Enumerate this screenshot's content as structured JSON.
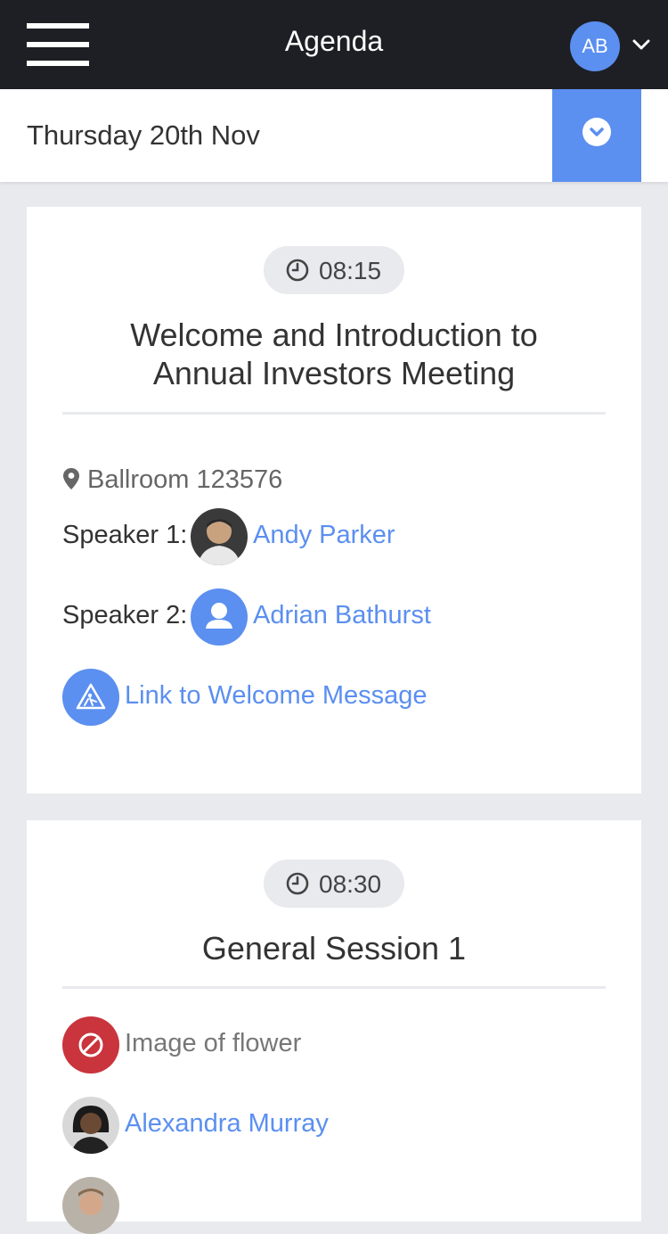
{
  "header": {
    "menu_icon": "hamburger-menu-icon",
    "title": "Agenda",
    "user_initials": "AB",
    "user_menu_icon": "chevron-down-icon"
  },
  "date_bar": {
    "label": "Thursday 20th Nov",
    "toggle_icon": "chevron-circle-down-icon"
  },
  "colors": {
    "accent": "#5b8ff0",
    "header_bg": "#1e1f24",
    "error": "#c9343d",
    "page_bg": "#e9eaee"
  },
  "sessions": [
    {
      "time": "08:15",
      "title_line1": "Welcome and Introduction to",
      "title_line2": "Annual Investors Meeting",
      "location": "Ballroom 123576",
      "speaker1_label": "Speaker 1:",
      "speaker1_name": "Andy Parker",
      "speaker2_label": "Speaker 2:",
      "speaker2_name": "Adrian Bathurst",
      "link_label": "Link to Welcome Message",
      "link_icon": "under-construction-icon"
    },
    {
      "time": "08:30",
      "title": "General Session 1",
      "broken_image_alt": "Image of flower",
      "broken_image_icon": "blocked-icon",
      "person_name": "Alexandra Murray"
    }
  ]
}
